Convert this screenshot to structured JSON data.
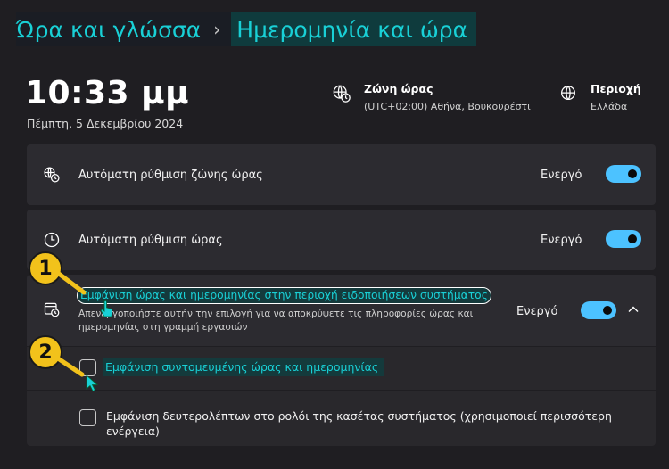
{
  "breadcrumb": {
    "parent": "Ώρα και γλώσσα",
    "separator": "›",
    "current": "Ημερομηνία και ώρα"
  },
  "clock": {
    "time": "10:33 μμ",
    "date": "Πέμπτη, 5 Δεκεμβρίου 2024"
  },
  "timezone": {
    "title": "Ζώνη ώρας",
    "value": "(UTC+02:00) Αθήνα, Βουκουρέστι",
    "icon": "globe-clock-icon"
  },
  "region": {
    "title": "Περιοχή",
    "value": "Ελλάδα",
    "icon": "globe-icon"
  },
  "settings": [
    {
      "label": "Αυτόματη ρύθμιση ζώνης ώρας",
      "state": "Ενεργό",
      "on": true,
      "icon": "globe-clock-icon"
    },
    {
      "label": "Αυτόματη ρύθμιση ώρας",
      "state": "Ενεργό",
      "on": true,
      "icon": "clock-icon"
    },
    {
      "label": "Εμφάνιση ώρας και ημερομηνίας στην περιοχή ειδοποιήσεων συστήματος",
      "description": "Απενεργοποιήστε αυτήν την επιλογή για να αποκρύψετε τις πληροφορίες ώρας και ημερομηνίας στη γραμμή εργασιών",
      "state": "Ενεργό",
      "on": true,
      "expanded": true,
      "icon": "calendar-clock-icon"
    }
  ],
  "subOptions": [
    {
      "label": "Εμφάνιση συντομευμένης ώρας και ημερομηνίας",
      "checked": false
    },
    {
      "label": "Εμφάνιση δευτερολέπτων στο ρολόι της κασέτας συστήματος (χρησιμοποιεί περισσότερη ενέργεια)",
      "checked": false
    }
  ],
  "callouts": [
    "1",
    "2"
  ],
  "colors": {
    "accent": "#4cc2ff",
    "highlight": "#19d0d6",
    "badge": "#f2c21b"
  }
}
